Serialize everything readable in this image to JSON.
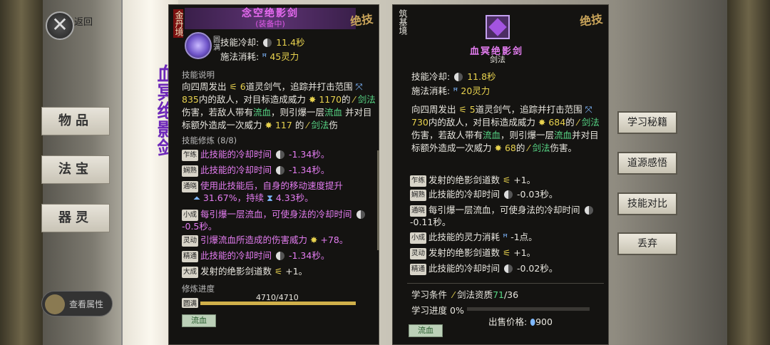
{
  "background": {
    "back_label": "返回",
    "side_tabs": [
      "物品",
      "法宝",
      "器灵"
    ],
    "scroll_text": "血冥绝影剑",
    "view_attr_label": "查看属性"
  },
  "left_panel": {
    "realm": "金丹境",
    "jueji": "绝技",
    "title": "念空绝影剑",
    "subtitle": "(装备中)",
    "badge": "圆满",
    "cooldown_label": "技能冷却:",
    "cooldown": "11.4秒",
    "cost_label": "施法消耗:",
    "cost": "45灵力",
    "desc_header": "技能说明",
    "desc": {
      "p1": "向四周发出",
      "count": "6",
      "p2": "道灵剑气，追踪并打击范围",
      "range": "835",
      "p3": "内的敌人，对目标造成威力",
      "power": "1170",
      "p4": "的",
      "sword": "剑法",
      "p5": "伤害，若敌人带有",
      "bleed": "流血",
      "p6": "，则引爆一层",
      "bleed2": "流血",
      "p7": "并对目标额外造成一次威力",
      "extra": "117",
      "p8": "的",
      "sword2": "剑法",
      "p9": "伤"
    },
    "practice_header": "技能修炼 (8/8)",
    "mods": [
      {
        "tag": "乍练",
        "text": "此技能的冷却时间",
        "val": "-1.34秒。"
      },
      {
        "tag": "娴熟",
        "text": "此技能的冷却时间",
        "val": "-1.34秒。"
      },
      {
        "tag": "通晓",
        "text": "使用此技能后，自身的移动速度提升",
        "val": "31.67%，持续",
        "val2": "4.33秒。"
      },
      {
        "tag": "小成",
        "text": "每引爆一层流血，可使身法的冷却时间",
        "val": "-0.5秒。"
      },
      {
        "tag": "灵动",
        "text": "引爆流血所造成的伤害威力",
        "val": "+78。"
      },
      {
        "tag": "精通",
        "text": "此技能的冷却时间",
        "val": "-1.34秒。"
      },
      {
        "tag": "大成",
        "text": "发射的绝影剑道数",
        "val": "+1。"
      }
    ],
    "progress_label": "修炼进度",
    "progress_text": "4710/4710",
    "progress_fraction": 1.0,
    "progress_badge": "圆满",
    "bleed_button": "流血"
  },
  "right_panel": {
    "realm": "筑基境",
    "jueji": "绝技",
    "title": "血冥绝影剑",
    "category": "剑法",
    "cooldown_label": "技能冷却:",
    "cooldown": "11.8秒",
    "cost_label": "施法消耗:",
    "cost": "20灵力",
    "desc": {
      "p1": "向四周发出",
      "count": "5",
      "p2": "道灵剑气，追踪并打击范围",
      "range": "730",
      "p3": "内的敌人，对目标造成威力",
      "power": "684",
      "p4": "的",
      "sword": "剑法",
      "p5": "伤害，若敌人带有",
      "bleed": "流血",
      "p6": "，则引爆一层",
      "bleed2": "流血",
      "p7": "并对目标额外造成一次威力",
      "extra": "68",
      "p8": "的",
      "sword2": "剑法",
      "p9": "伤害。"
    },
    "mods": [
      {
        "tag": "乍练",
        "text": "发射的绝影剑道数",
        "val": "+1。"
      },
      {
        "tag": "娴熟",
        "text": "此技能的冷却时间",
        "val": "-0.03秒。"
      },
      {
        "tag": "通晓",
        "text": "每引爆一层流血，可使身法的冷却时间",
        "val": "-0.11秒。"
      },
      {
        "tag": "小成",
        "text": "此技能的灵力消耗",
        "val": "-1点。"
      },
      {
        "tag": "灵动",
        "text": "发射的绝影剑道数",
        "val": "+1。"
      },
      {
        "tag": "精通",
        "text": "此技能的冷却时间",
        "val": "-0.02秒。"
      }
    ],
    "learn_cond_label": "学习条件",
    "learn_cond_text": "剑法资质",
    "learn_cond_have": "71",
    "learn_cond_need": "/36",
    "learn_progress_label": "学习进度",
    "learn_progress_value": "0%",
    "learn_progress_fraction": 0.0,
    "price_label": "出售价格:",
    "price": "900",
    "bleed_button": "流血"
  },
  "actions": [
    "学习秘籍",
    "道源感悟",
    "技能对比",
    "丢弃"
  ],
  "colors": {
    "accent_purple": "#e37cf0",
    "value_yellow": "#e8d24e",
    "bleed_green": "#57d685",
    "panel_bg": "#141311"
  }
}
